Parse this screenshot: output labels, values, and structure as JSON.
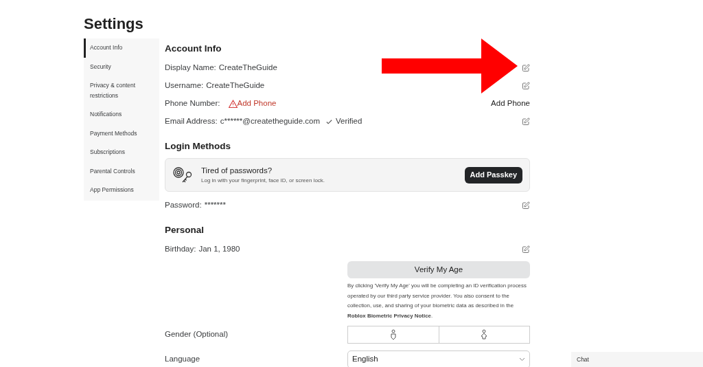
{
  "page_title": "Settings",
  "sidebar": {
    "items": [
      {
        "label": "Account Info",
        "selected": true
      },
      {
        "label": "Security",
        "selected": false
      },
      {
        "label": "Privacy & content restrictions",
        "selected": false
      },
      {
        "label": "Notifications",
        "selected": false
      },
      {
        "label": "Payment Methods",
        "selected": false
      },
      {
        "label": "Subscriptions",
        "selected": false
      },
      {
        "label": "Parental Controls",
        "selected": false
      },
      {
        "label": "App Permissions",
        "selected": false
      }
    ]
  },
  "account_info": {
    "heading": "Account Info",
    "rows": [
      {
        "label": "Display Name:",
        "value": "CreateTheGuide",
        "warning": false,
        "kind": "edit"
      },
      {
        "label": "Username:",
        "value": "CreateTheGuide",
        "warning": false,
        "kind": "edit"
      },
      {
        "label": "Phone Number:",
        "value": "Add Phone",
        "warning": true,
        "kind": "link",
        "action_label": "Add Phone"
      },
      {
        "label": "Email Address:",
        "value": "c******@createtheguide.com",
        "warning": false,
        "verified": "Verified",
        "kind": "edit"
      }
    ]
  },
  "login_methods": {
    "heading": "Login Methods",
    "passkey_card": {
      "title": "Tired of passwords?",
      "subtitle": "Log in with your fingerprint, face ID, or screen lock.",
      "button": "Add Passkey"
    },
    "rows": [
      {
        "label": "Password:",
        "value": "*******",
        "warning": false,
        "kind": "edit"
      }
    ]
  },
  "personal": {
    "heading": "Personal",
    "rows": [
      {
        "label": "Birthday:",
        "value": "Jan 1, 1980",
        "warning": false,
        "kind": "edit"
      }
    ],
    "verify_button": "Verify My Age",
    "verify_notice": "By clicking 'Verify My Age' you will be completing an ID verification process operated by our third party service provider. You also consent to the collection, use, and sharing of your biometric data as described in the **Roblox Biometric Privacy Notice**.",
    "gender": {
      "label": "Gender (Optional)"
    },
    "language": {
      "label": "Language",
      "value": "English"
    }
  },
  "chat": {
    "label": "Chat"
  }
}
